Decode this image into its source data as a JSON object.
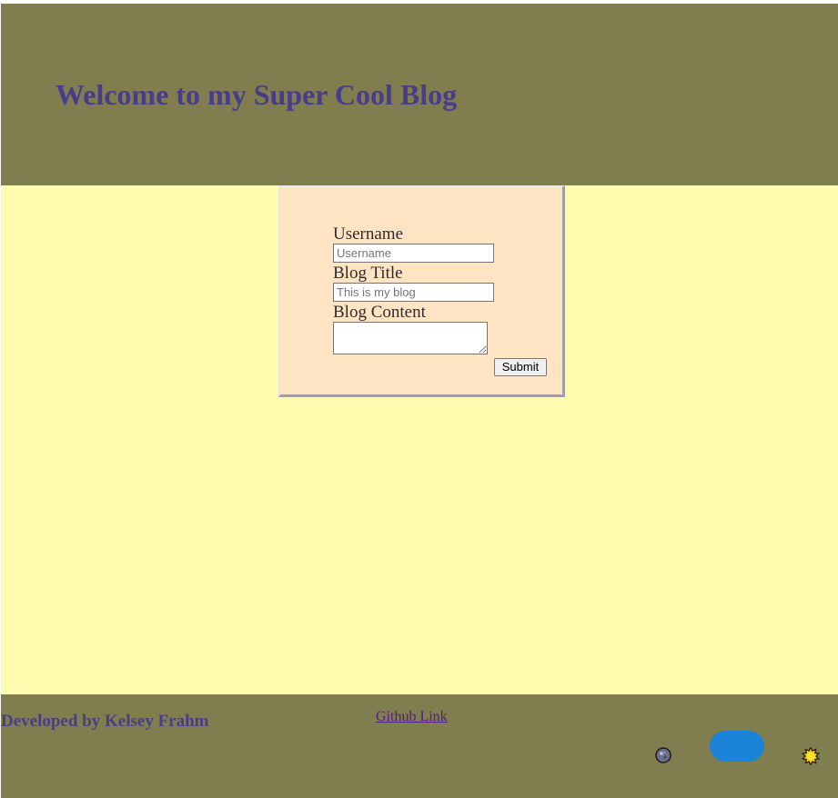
{
  "header": {
    "title": "Welcome to my Super Cool Blog"
  },
  "form": {
    "username_label": "Username",
    "username_placeholder": "Username",
    "blog_title_label": "Blog Title",
    "blog_title_placeholder": "This is my blog",
    "blog_content_label": "Blog Content",
    "submit_label": "Submit"
  },
  "footer": {
    "developer_credit": "Developed by Kelsey Frahm",
    "github_link_text": "Github Link"
  },
  "theme_toggle": {
    "left_icon": "moon-icon",
    "right_icon": "sun-icon",
    "toggle_color": "#1b84d8"
  },
  "colors": {
    "header_bg": "#807d4e",
    "main_bg": "#fffcb0",
    "card_bg": "#ffe4c4",
    "heading_text": "#483d8b",
    "link_text": "#551a8b"
  }
}
